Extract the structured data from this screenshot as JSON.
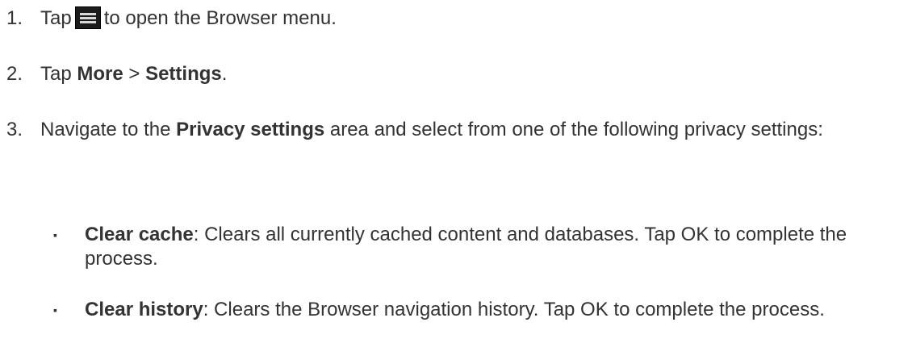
{
  "steps": [
    {
      "number": "1.",
      "pre": "Tap",
      "icon": "menu-icon",
      "post": "to open the Browser menu."
    },
    {
      "number": "2.",
      "pre": "Tap ",
      "bold1": "More",
      "mid": " > ",
      "bold2": "Settings",
      "post": "."
    },
    {
      "number": "3.",
      "pre": "Navigate to the ",
      "bold": "Privacy settings",
      "post": " area and select from one of the following privacy settings:"
    }
  ],
  "bullets": [
    {
      "marker": "▪",
      "bold": "Clear cache",
      "text": ": Clears all currently cached content and databases. Tap OK to complete the process."
    },
    {
      "marker": "▪",
      "bold": "Clear history",
      "text": ": Clears the Browser navigation history. Tap OK to complete the process."
    }
  ]
}
